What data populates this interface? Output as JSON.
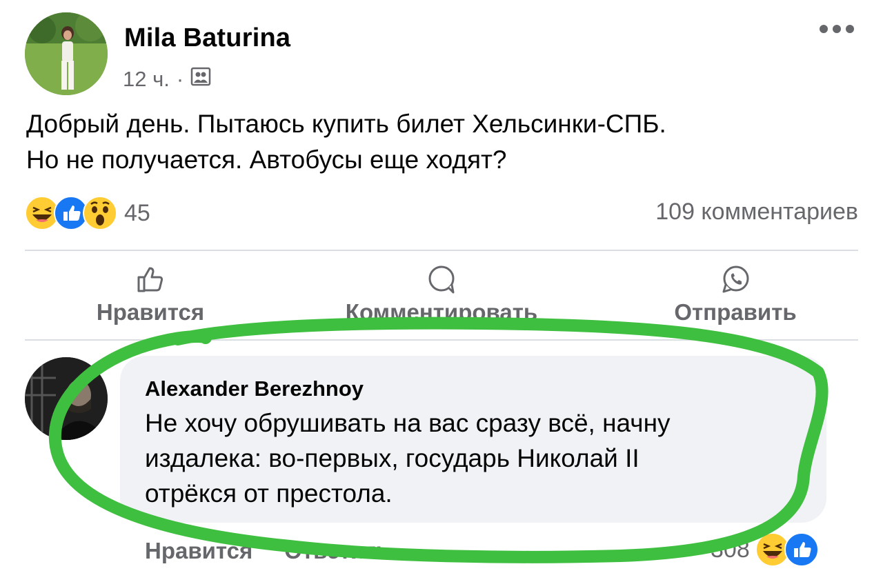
{
  "post": {
    "author": "Mila Baturina",
    "time": "12 ч.",
    "separator": "·",
    "audience_icon": "friends-icon",
    "text_line1": "Добрый день. Пытаюсь купить билет Хельсинки-СПБ.",
    "text_line2": "Но не получается. Автобусы еще ходят?",
    "reactions": [
      "haha-icon",
      "like-icon",
      "wow-icon"
    ],
    "reaction_count": "45",
    "comment_count": "109 комментариев"
  },
  "actions": {
    "like": "Нравится",
    "comment": "Комментировать",
    "share": "Отправить"
  },
  "comment": {
    "author": "Alexander Berezhnoy",
    "text_line1": "Не хочу обрушивать на вас сразу всё, начну",
    "text_line2": "издалека: во-первых, государь Николай II",
    "text_line3": "отрёкся от престола.",
    "like": "Нравится",
    "reply": "Ответить",
    "reaction_count": "308",
    "reactions": [
      "haha-icon",
      "like-icon"
    ]
  },
  "colors": {
    "secondary_text": "#65676b",
    "bubble_bg": "#f0f2f5",
    "like_blue": "#1877f2",
    "annotation_green": "#3fbf3f"
  }
}
